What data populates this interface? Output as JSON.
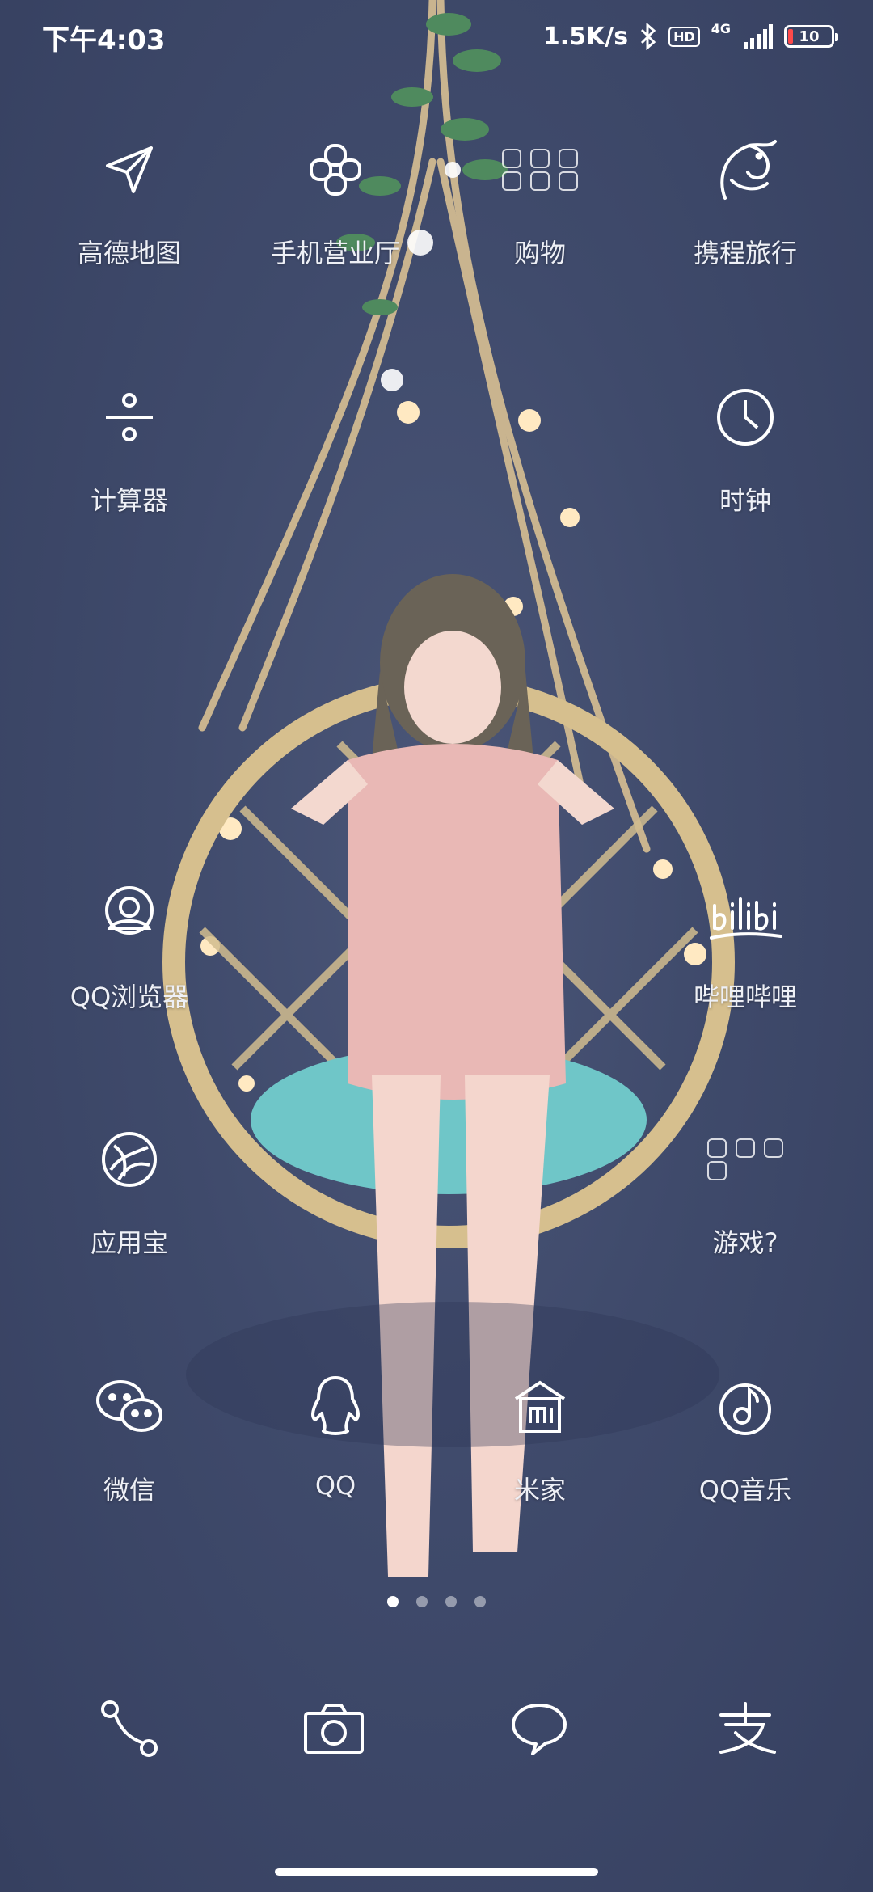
{
  "status_bar": {
    "time": "下午4:03",
    "net_speed": "1.5K/s",
    "hd": "HD",
    "net_type": "4G",
    "battery": "10"
  },
  "apps": {
    "amap": {
      "label": "高德地图",
      "icon": "navigation-arrow-icon"
    },
    "unicom": {
      "label": "手机营业厅",
      "icon": "china-unicom-knot-icon"
    },
    "shopping": {
      "label": "购物",
      "icon": "folder-icon"
    },
    "ctrip": {
      "label": "携程旅行",
      "icon": "dolphin-icon"
    },
    "calculator": {
      "label": "计算器",
      "icon": "divide-icon"
    },
    "clock": {
      "label": "时钟",
      "icon": "clock-icon"
    },
    "qq_browser": {
      "label": "QQ浏览器",
      "icon": "qq-browser-icon"
    },
    "bilibili": {
      "label": "哔哩哔哩",
      "icon": "bilibili-logo-icon"
    },
    "app_store": {
      "label": "应用宝",
      "icon": "app-store-icon"
    },
    "games": {
      "label": "游戏?",
      "icon": "folder-icon"
    },
    "wechat": {
      "label": "微信",
      "icon": "wechat-icon"
    },
    "qq": {
      "label": "QQ",
      "icon": "qq-penguin-icon"
    },
    "mi_home": {
      "label": "米家",
      "icon": "mi-home-icon"
    },
    "qq_music": {
      "label": "QQ音乐",
      "icon": "qq-music-icon"
    }
  },
  "pages": {
    "count": 4,
    "active": 1
  },
  "dock": [
    "phone-icon",
    "camera-icon",
    "message-icon",
    "alipay-icon"
  ]
}
